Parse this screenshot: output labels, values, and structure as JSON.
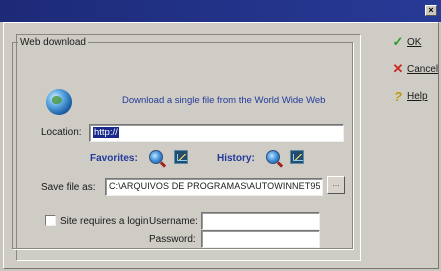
{
  "window": {
    "close_glyph": "×"
  },
  "group": {
    "title": "Web download",
    "subtitle": "Download a single file from the World Wide Web"
  },
  "location": {
    "label": "Location:",
    "value": "http://"
  },
  "favorites": {
    "label": "Favorites:"
  },
  "history": {
    "label": "History:"
  },
  "save": {
    "label": "Save file as:",
    "value": "C:\\ARQUIVOS DE PROGRAMAS\\AUTOWINNET95",
    "browse_glyph": "…"
  },
  "login": {
    "checkbox_label": "Site requires a login",
    "checked": false,
    "username_label": "Username:",
    "username_value": "",
    "password_label": "Password:",
    "password_value": ""
  },
  "buttons": {
    "ok_label": "OK",
    "cancel_label": "Cancel",
    "help_label": "Help",
    "ok_icon": "checkmark-icon",
    "cancel_icon": "x-icon",
    "help_icon": "question-icon"
  },
  "colors": {
    "title_bar": "#1d2a78",
    "accent_text": "#233a9a",
    "selection": "#1a2a8a"
  }
}
